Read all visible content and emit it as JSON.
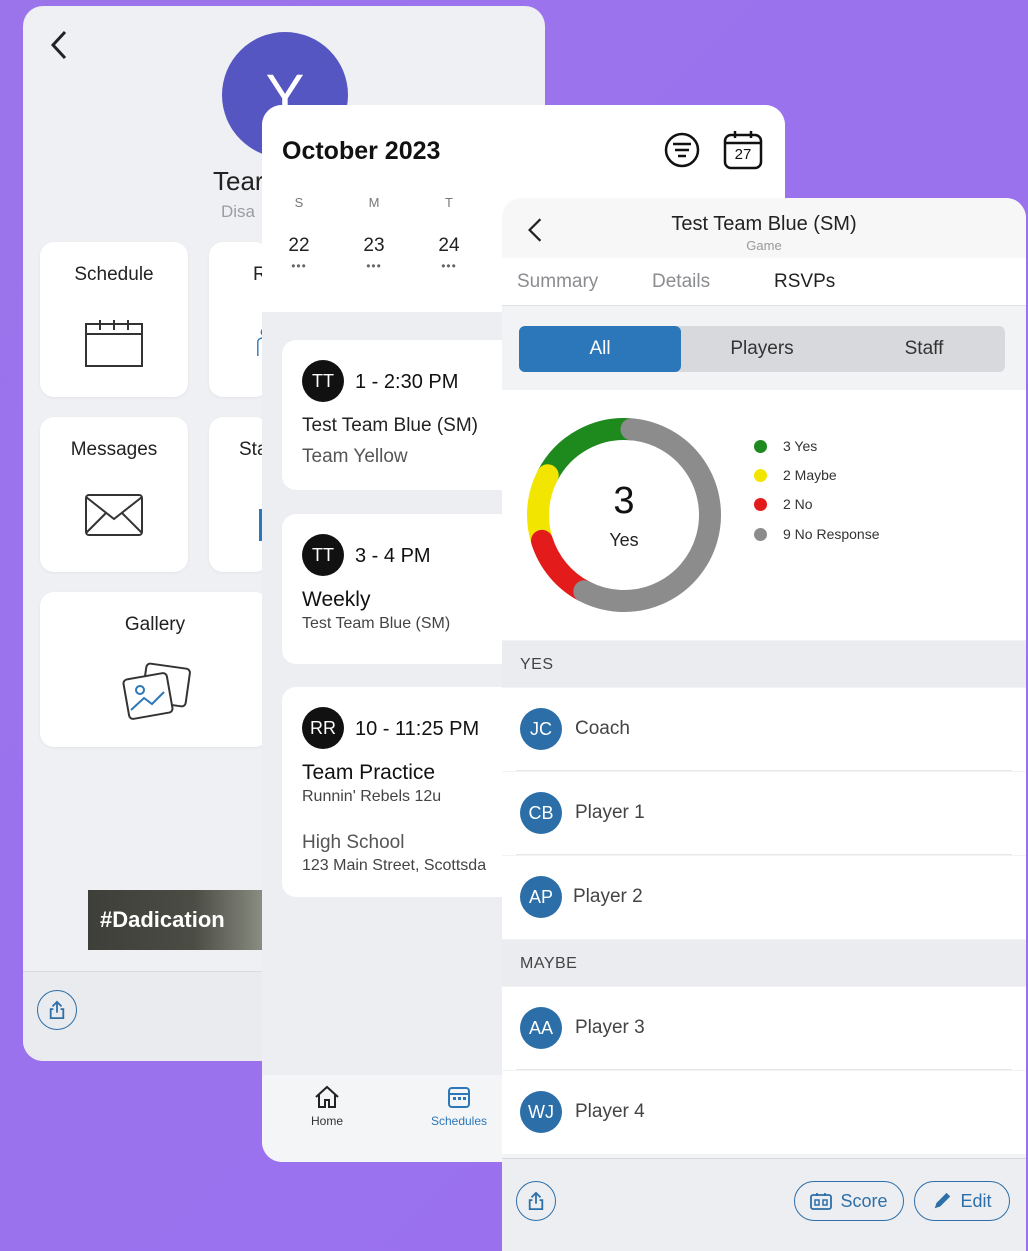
{
  "team": {
    "avatar_letter": "Y",
    "name": "Tear",
    "sub": "Disa",
    "tiles": {
      "schedule": "Schedule",
      "r_partial": "R",
      "messages": "Messages",
      "stats_partial": "Sta",
      "gallery": "Gallery"
    },
    "banner_text": "#Dadication"
  },
  "schedule": {
    "month": "October 2023",
    "calendar_icon_day": "27",
    "days": [
      {
        "dow": "S",
        "num": "22",
        "dots": "•••"
      },
      {
        "dow": "M",
        "num": "23",
        "dots": "•••"
      },
      {
        "dow": "T",
        "num": "24",
        "dots": "•••"
      }
    ],
    "events": [
      {
        "badge": "TT",
        "time": "1 - 2:30 PM",
        "line1": "Test Team Blue (SM)",
        "line2": "Team Yellow"
      },
      {
        "badge": "TT",
        "time": "3 - 4 PM",
        "line1": "Weekly",
        "line2": "Test Team Blue (SM)"
      },
      {
        "badge": "RR",
        "time": "10 - 11:25 PM",
        "line1": "Team Practice",
        "line2": "Runnin' Rebels 12u",
        "line3": "High School",
        "line4": "123 Main Street, Scottsda"
      }
    ],
    "tabbar": {
      "home": "Home",
      "schedules": "Schedules"
    }
  },
  "event": {
    "title": "Test Team Blue (SM)",
    "subtitle": "Game",
    "tabs": [
      "Summary",
      "Details",
      "RSVPs"
    ],
    "segments": [
      "All",
      "Players",
      "Staff"
    ],
    "center_number": "3",
    "center_label": "Yes",
    "legend": [
      {
        "label": "3 Yes",
        "count": 3,
        "color": "#1e8a1e"
      },
      {
        "label": "2 Maybe",
        "count": 2,
        "color": "#f2e600"
      },
      {
        "label": "2 No",
        "count": 2,
        "color": "#e31b1b"
      },
      {
        "label": "9 No Response",
        "count": 9,
        "color": "#8c8c8c"
      }
    ],
    "sections": {
      "yes": "YES",
      "maybe": "MAYBE"
    },
    "yes_people": [
      {
        "initials": "JC",
        "name": "Coach"
      },
      {
        "initials": "CB",
        "name": "Player 1"
      },
      {
        "initials": "AP",
        "name": "Player 2"
      }
    ],
    "maybe_people": [
      {
        "initials": "AA",
        "name": "Player 3"
      },
      {
        "initials": "WJ",
        "name": "Player 4"
      }
    ],
    "score_label": "Score",
    "edit_label": "Edit"
  }
}
